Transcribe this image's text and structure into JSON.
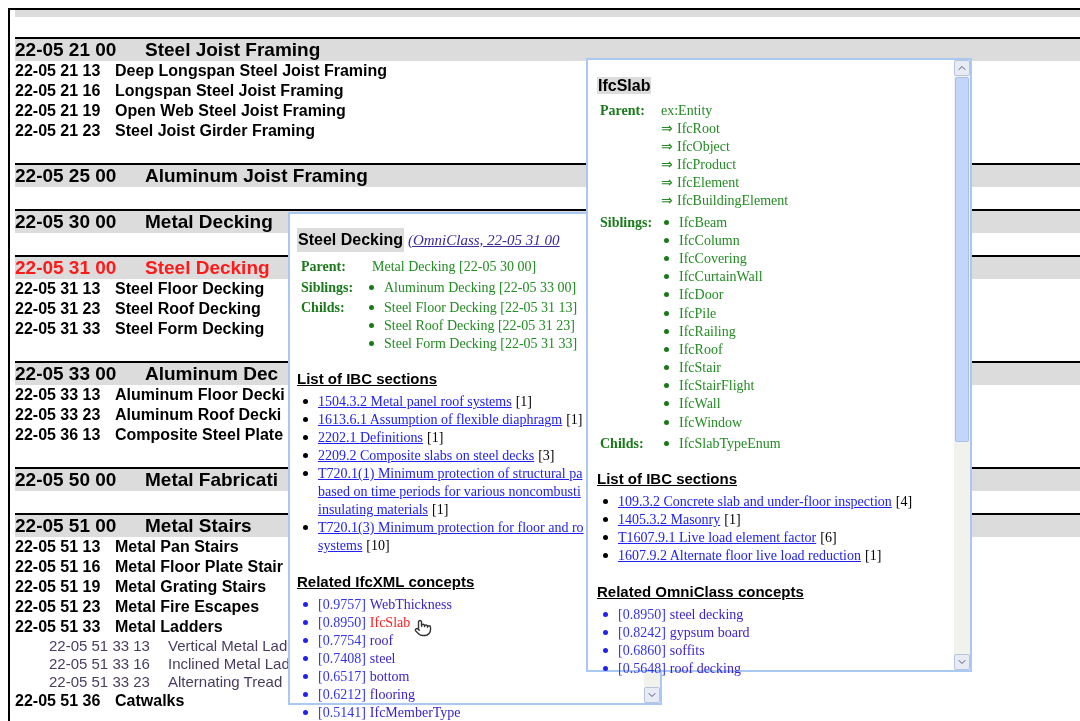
{
  "sections": [
    {
      "code": "22-05 21 00",
      "title": "Steel Joist Framing",
      "highlighted": false,
      "items": [
        {
          "code": "22-05 21 13",
          "title": "Deep Longspan Steel Joist Framing"
        },
        {
          "code": "22-05 21 16",
          "title": "Longspan Steel Joist Framing"
        },
        {
          "code": "22-05 21 19",
          "title": "Open Web Steel Joist Framing"
        },
        {
          "code": "22-05 21 23",
          "title": "Steel Joist Girder Framing"
        }
      ]
    },
    {
      "code": "22-05 25 00",
      "title": "Aluminum Joist Framing",
      "highlighted": false
    },
    {
      "code": "22-05 30 00",
      "title": "Metal Decking",
      "highlighted": false
    },
    {
      "code": "22-05 31 00",
      "title": "Steel Decking",
      "highlighted": true,
      "items": [
        {
          "code": "22-05 31 13",
          "title": "Steel Floor Decking"
        },
        {
          "code": "22-05 31 23",
          "title": "Steel Roof Decking"
        },
        {
          "code": "22-05 31 33",
          "title": "Steel Form Decking"
        }
      ]
    },
    {
      "code": "22-05 33 00",
      "title": "Aluminum Dec",
      "highlighted": false,
      "items": [
        {
          "code": "22-05 33 13",
          "title": "Aluminum Floor Decki"
        },
        {
          "code": "22-05 33 23",
          "title": "Aluminum Roof Decki"
        },
        {
          "code": "22-05 36 13",
          "title": "Composite Steel Plate"
        }
      ]
    },
    {
      "code": "22-05 50 00",
      "title": "Metal Fabricati",
      "highlighted": false
    },
    {
      "code": "22-05 51 00",
      "title": "Metal Stairs",
      "highlighted": false,
      "items": [
        {
          "code": "22-05 51 13",
          "title": "Metal Pan Stairs"
        },
        {
          "code": "22-05 51 16",
          "title": "Metal Floor Plate Stair"
        },
        {
          "code": "22-05 51 19",
          "title": "Metal Grating Stairs"
        },
        {
          "code": "22-05 51 23",
          "title": "Metal Fire Escapes"
        },
        {
          "code": "22-05 51 33",
          "title": "Metal Ladders",
          "children": [
            {
              "code": "22-05 51 33 13",
              "title": "Vertical Metal Lad"
            },
            {
              "code": "22-05 51 33 16",
              "title": "Inclined Metal Lad"
            },
            {
              "code": "22-05 51 33 23",
              "title": "Alternating Tread"
            }
          ]
        },
        {
          "code": "22-05 51 36",
          "title": "Catwalks"
        }
      ]
    }
  ],
  "popup_omniclass": {
    "title": "Steel Decking",
    "source": "(OmniClass, 22-05 31 00",
    "parent_label": "Parent:",
    "parent": "Metal Decking [22-05 30 00]",
    "siblings_label": "Siblings:",
    "siblings": [
      "Aluminum Decking [22-05 33 00]"
    ],
    "childs_label": "Childs:",
    "childs": [
      "Steel Floor Decking [22-05 31 13]",
      "Steel Roof Decking [22-05 31 23]",
      "Steel Form Decking [22-05 31 33]"
    ],
    "ibc_heading": "List of IBC sections",
    "ibc": [
      {
        "lines": [
          "1504.3.2 Metal panel roof systems"
        ],
        "count": "[1]"
      },
      {
        "lines": [
          "1613.6.1 Assumption of flexible diaphragm"
        ],
        "count": "[1]"
      },
      {
        "lines": [
          "2202.1 Definitions"
        ],
        "count": "[1]"
      },
      {
        "lines": [
          "2209.2 Composite slabs on steel decks"
        ],
        "count": "[3]"
      },
      {
        "lines": [
          "T720.1(1) Minimum protection of structural pa",
          "based on time periods for various noncombusti",
          "insulating materials"
        ],
        "count": "[1]"
      },
      {
        "lines": [
          "T720.1(3) Minimum protection for floor and ro",
          "systems"
        ],
        "count": "[10]"
      }
    ],
    "related_heading": "Related IfcXML concepts",
    "related": [
      {
        "score": "[0.9757]",
        "name": "WebThickness",
        "selected": false
      },
      {
        "score": "[0.8950]",
        "name": "IfcSlab",
        "selected": true
      },
      {
        "score": "[0.7754]",
        "name": "roof",
        "selected": false
      },
      {
        "score": "[0.7408]",
        "name": "steel",
        "selected": false
      },
      {
        "score": "[0.6517]",
        "name": "bottom",
        "selected": false
      },
      {
        "score": "[0.6212]",
        "name": "flooring",
        "selected": false
      },
      {
        "score": "[0.5141]",
        "name": "IfcMemberType",
        "selected": false
      }
    ]
  },
  "popup_ifc": {
    "title": "IfcSlab",
    "parent_label": "Parent:",
    "parent": "ex:Entity",
    "ancestors": [
      {
        "arrow": "⇒",
        "name": "IfcRoot"
      },
      {
        "arrow": "⇒",
        "name": "IfcObject"
      },
      {
        "arrow": "⇒",
        "name": "IfcProduct"
      },
      {
        "arrow": "⇒",
        "name": "IfcElement"
      },
      {
        "arrow": "⇒",
        "name": "IfcBuildingElement"
      }
    ],
    "siblings_label": "Siblings:",
    "siblings": [
      "IfcBeam",
      "IfcColumn",
      "IfcCovering",
      "IfcCurtainWall",
      "IfcDoor",
      "IfcPile",
      "IfcRailing",
      "IfcRoof",
      "IfcStair",
      "IfcStairFlight",
      "IfcWall",
      "IfcWindow"
    ],
    "childs_label": "Childs:",
    "childs": [
      "IfcSlabTypeEnum"
    ],
    "ibc_heading": "List of IBC sections",
    "ibc": [
      {
        "lines": [
          "109.3.2 Concrete slab and under-floor inspection"
        ],
        "count": "[4]"
      },
      {
        "lines": [
          "1405.3.2 Masonry"
        ],
        "count": "[1]"
      },
      {
        "lines": [
          "T1607.9.1 Live load element factor"
        ],
        "count": "[6]"
      },
      {
        "lines": [
          "1607.9.2 Alternate floor live load reduction"
        ],
        "count": "[1]"
      }
    ],
    "related_heading": "Related OmniClass concepts",
    "related": [
      {
        "score": "[0.8950]",
        "name": "steel decking",
        "selected": false
      },
      {
        "score": "[0.8242]",
        "name": "gypsum board",
        "selected": false
      },
      {
        "score": "[0.6860]",
        "name": "soffits",
        "selected": false
      },
      {
        "score": "[0.5648]",
        "name": "roof decking",
        "selected": false
      }
    ]
  }
}
